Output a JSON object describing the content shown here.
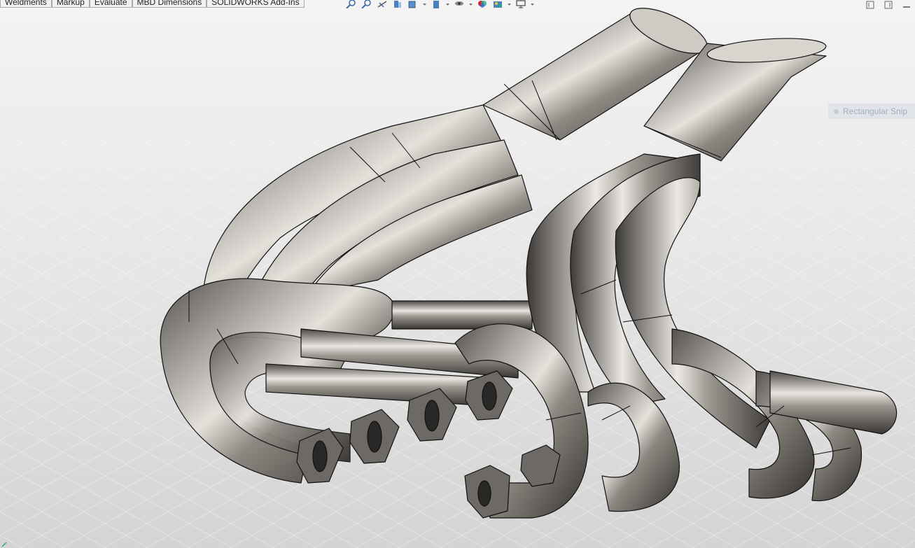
{
  "command_manager": {
    "tabs": [
      {
        "label": "Weldments"
      },
      {
        "label": "Markup"
      },
      {
        "label": "Evaluate"
      },
      {
        "label": "MBD Dimensions"
      },
      {
        "label": "SOLIDWORKS Add-Ins"
      }
    ]
  },
  "heads_up_toolbar": {
    "buttons": [
      "zoom-to-fit-icon",
      "zoom-to-area-icon",
      "previous-view-icon",
      "section-view-icon",
      "view-orientation-icon",
      "display-style-icon",
      "hide-show-items-icon",
      "edit-appearance-icon",
      "apply-scene-icon",
      "view-settings-icon"
    ]
  },
  "window_controls": [
    "tile-icon",
    "tile-right-icon",
    "minimize-icon"
  ],
  "snip_overlay": {
    "label": "Rectangular Snip"
  },
  "colors": {
    "background_top": "#ececec",
    "background_bottom": "#d6d6d6",
    "metal": "#8a8783"
  }
}
